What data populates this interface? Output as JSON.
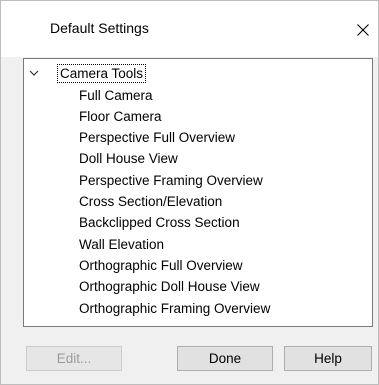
{
  "dialog": {
    "title": "Default Settings",
    "close_icon": "close-icon"
  },
  "tree": {
    "root": {
      "label": "Camera Tools",
      "expanded": true,
      "expander_icon": "chevron-down-icon"
    },
    "items": [
      "Full Camera",
      "Floor Camera",
      "Perspective Full Overview",
      "Doll House View",
      "Perspective Framing Overview",
      "Cross Section/Elevation",
      "Backclipped Cross Section",
      "Wall Elevation",
      "Orthographic Full Overview",
      "Orthographic Doll House View",
      "Orthographic Framing Overview"
    ]
  },
  "buttons": {
    "edit": "Edit...",
    "done": "Done",
    "help": "Help"
  },
  "colors": {
    "background": "#f0f0f0",
    "titlebar": "#ffffff",
    "tree_border": "#7a7a7a",
    "disabled_text": "#9a9a9a"
  }
}
